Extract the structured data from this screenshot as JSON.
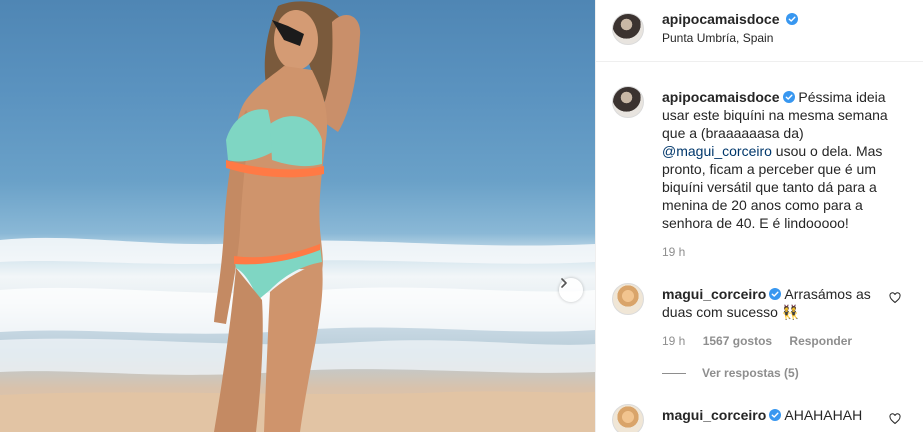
{
  "post": {
    "username": "apipocamaisdoce",
    "location": "Punta Umbría, Spain"
  },
  "caption": {
    "username": "apipocamaisdoce",
    "text_before": " Péssima ideia usar este biquíni na mesma semana que a (braaaaaasa da) ",
    "mention": "@magui_corceiro",
    "text_after": " usou o dela. Mas pronto, ficam a perceber que é um biquíni versátil que tanto dá para a menina de 20 anos como para a senhora de 40. E é lindooooo!",
    "time": "19 h"
  },
  "comments": [
    {
      "username": "magui_corceiro",
      "text": " Arrasámos as duas com sucesso 👯",
      "time": "19 h",
      "likes": "1567 gostos",
      "reply": "Responder",
      "view_replies": "Ver respostas (5)"
    },
    {
      "username": "magui_corceiro",
      "text": " AHAHAHAH"
    }
  ],
  "colors": {
    "verified": "#3897f0",
    "mention": "#00376b",
    "muted": "#8e8e8e"
  },
  "icons": [
    "verified-icon",
    "heart-icon",
    "chevron-right-icon"
  ]
}
